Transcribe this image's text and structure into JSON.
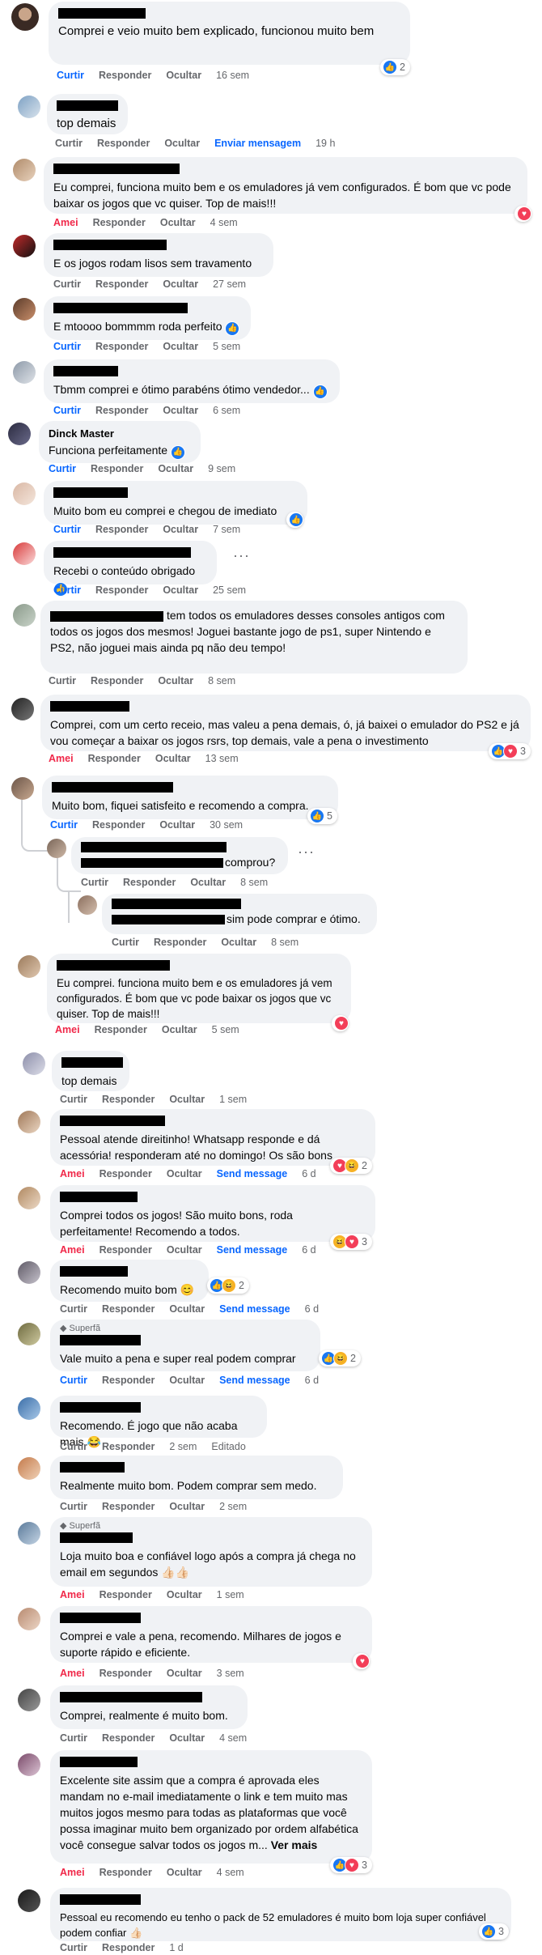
{
  "labels": {
    "like": "Curtir",
    "loved": "Amei",
    "reply": "Responder",
    "hide": "Ocultar",
    "send_message_pt": "Enviar mensagem",
    "send_message": "Send message",
    "edited": "Editado",
    "see_more": "Ver mais"
  },
  "colors": {
    "link_blue": "#0866ff",
    "love_red": "#f02849",
    "bubble": "#f0f2f5",
    "meta_gray": "#65676b"
  },
  "comments": [
    {
      "text": "Comprei e veio muito bem explicado, funcionou muito bem",
      "time": "16 sem",
      "count": "2"
    },
    {
      "text": "top demais",
      "time": "19 h"
    },
    {
      "text": "Eu comprei, funciona muito bem e os emuladores já vem configurados. É bom que vc pode baixar os jogos que vc quiser. Top de mais!!!",
      "time": "4 sem"
    },
    {
      "text": "E os jogos rodam lisos sem travamento",
      "time": "27 sem"
    },
    {
      "text": "E mtoooo bommmm roda perfeito",
      "time": "5 sem"
    },
    {
      "text": "Tbmm comprei e ótimo parabéns ótimo vendedor...",
      "time": "6 sem"
    },
    {
      "name": "Dinck Master",
      "text": "Funciona perfeitamente",
      "time": "9 sem"
    },
    {
      "text": "Muito bom eu comprei e chegou de imediato",
      "time": "7 sem"
    },
    {
      "text": "Recebi o conteúdo obrigado",
      "time": "25 sem"
    },
    {
      "text": "tem todos os emuladores desses consoles antigos com todos os jogos dos mesmos! Joguei bastante jogo de ps1, super Nintendo e PS2, não joguei mais ainda pq não deu tempo!",
      "time": "8 sem"
    },
    {
      "text": "Comprei, com um certo receio, mas valeu a pena demais, ó, já baixei o emulador do PS2 e já vou começar a baixar os jogos rsrs, top demais, vale a pena o investimento",
      "time": "13 sem",
      "count": "3"
    },
    {
      "text": "Muito bom, fiquei satisfeito e recomendo a compra.",
      "time": "30 sem",
      "count": "5"
    },
    {
      "text": "comprou?",
      "time": "8 sem"
    },
    {
      "text": "sim pode comprar e ótimo.",
      "time": "8 sem"
    },
    {
      "text": "Eu comprei. funciona muito bem e os emuladores já vem configurados. É bom que vc pode baixar os jogos que vc quiser. Top de mais!!!",
      "time": "5 sem"
    },
    {
      "text": "top demais",
      "time": "1 sem"
    },
    {
      "text": "Pessoal atende direitinho! Whatsapp responde e dá acessória! responderam até no domingo! Os são bons",
      "time": "6 d",
      "count": "2"
    },
    {
      "text": "Comprei todos os jogos! São muito bons, roda perfeitamente! Recomendo a todos.",
      "time": "6 d",
      "count": "3"
    },
    {
      "text": "Recomendo muito bom 😊",
      "time": "6 d",
      "count": "2"
    },
    {
      "badge": "Superfã",
      "text": "Vale muito a pena e super real podem comprar",
      "time": "6 d",
      "count": "2"
    },
    {
      "text": "Recomendo. É jogo que não acaba mais 😂",
      "time": "2 sem"
    },
    {
      "text": "Realmente muito bom. Podem comprar sem medo.",
      "time": "2 sem"
    },
    {
      "badge": "Superfã",
      "text": "Loja muito boa e confiável logo após a compra já chega no email em segundos 👍🏻👍🏻",
      "time": "1 sem"
    },
    {
      "text": "Comprei e vale a pena, recomendo. Milhares de jogos e suporte rápido e eficiente.",
      "time": "3 sem"
    },
    {
      "text": "Comprei, realmente é muito bom.",
      "time": "4 sem"
    },
    {
      "text": "Excelente site assim que a compra é aprovada eles mandam no e-mail imediatamente o link e tem muito mas muitos jogos mesmo para todas as plataformas que você possa imaginar muito bem organizado por ordem alfabética você consegue salvar todos os jogos m...",
      "time": "4 sem",
      "count": "3"
    },
    {
      "text": "Pessoal eu recomendo eu tenho o pack de 52 emuladores é muito bom loja super confiável podem confiar 👍🏻",
      "time": "1 d",
      "count": "3"
    }
  ]
}
